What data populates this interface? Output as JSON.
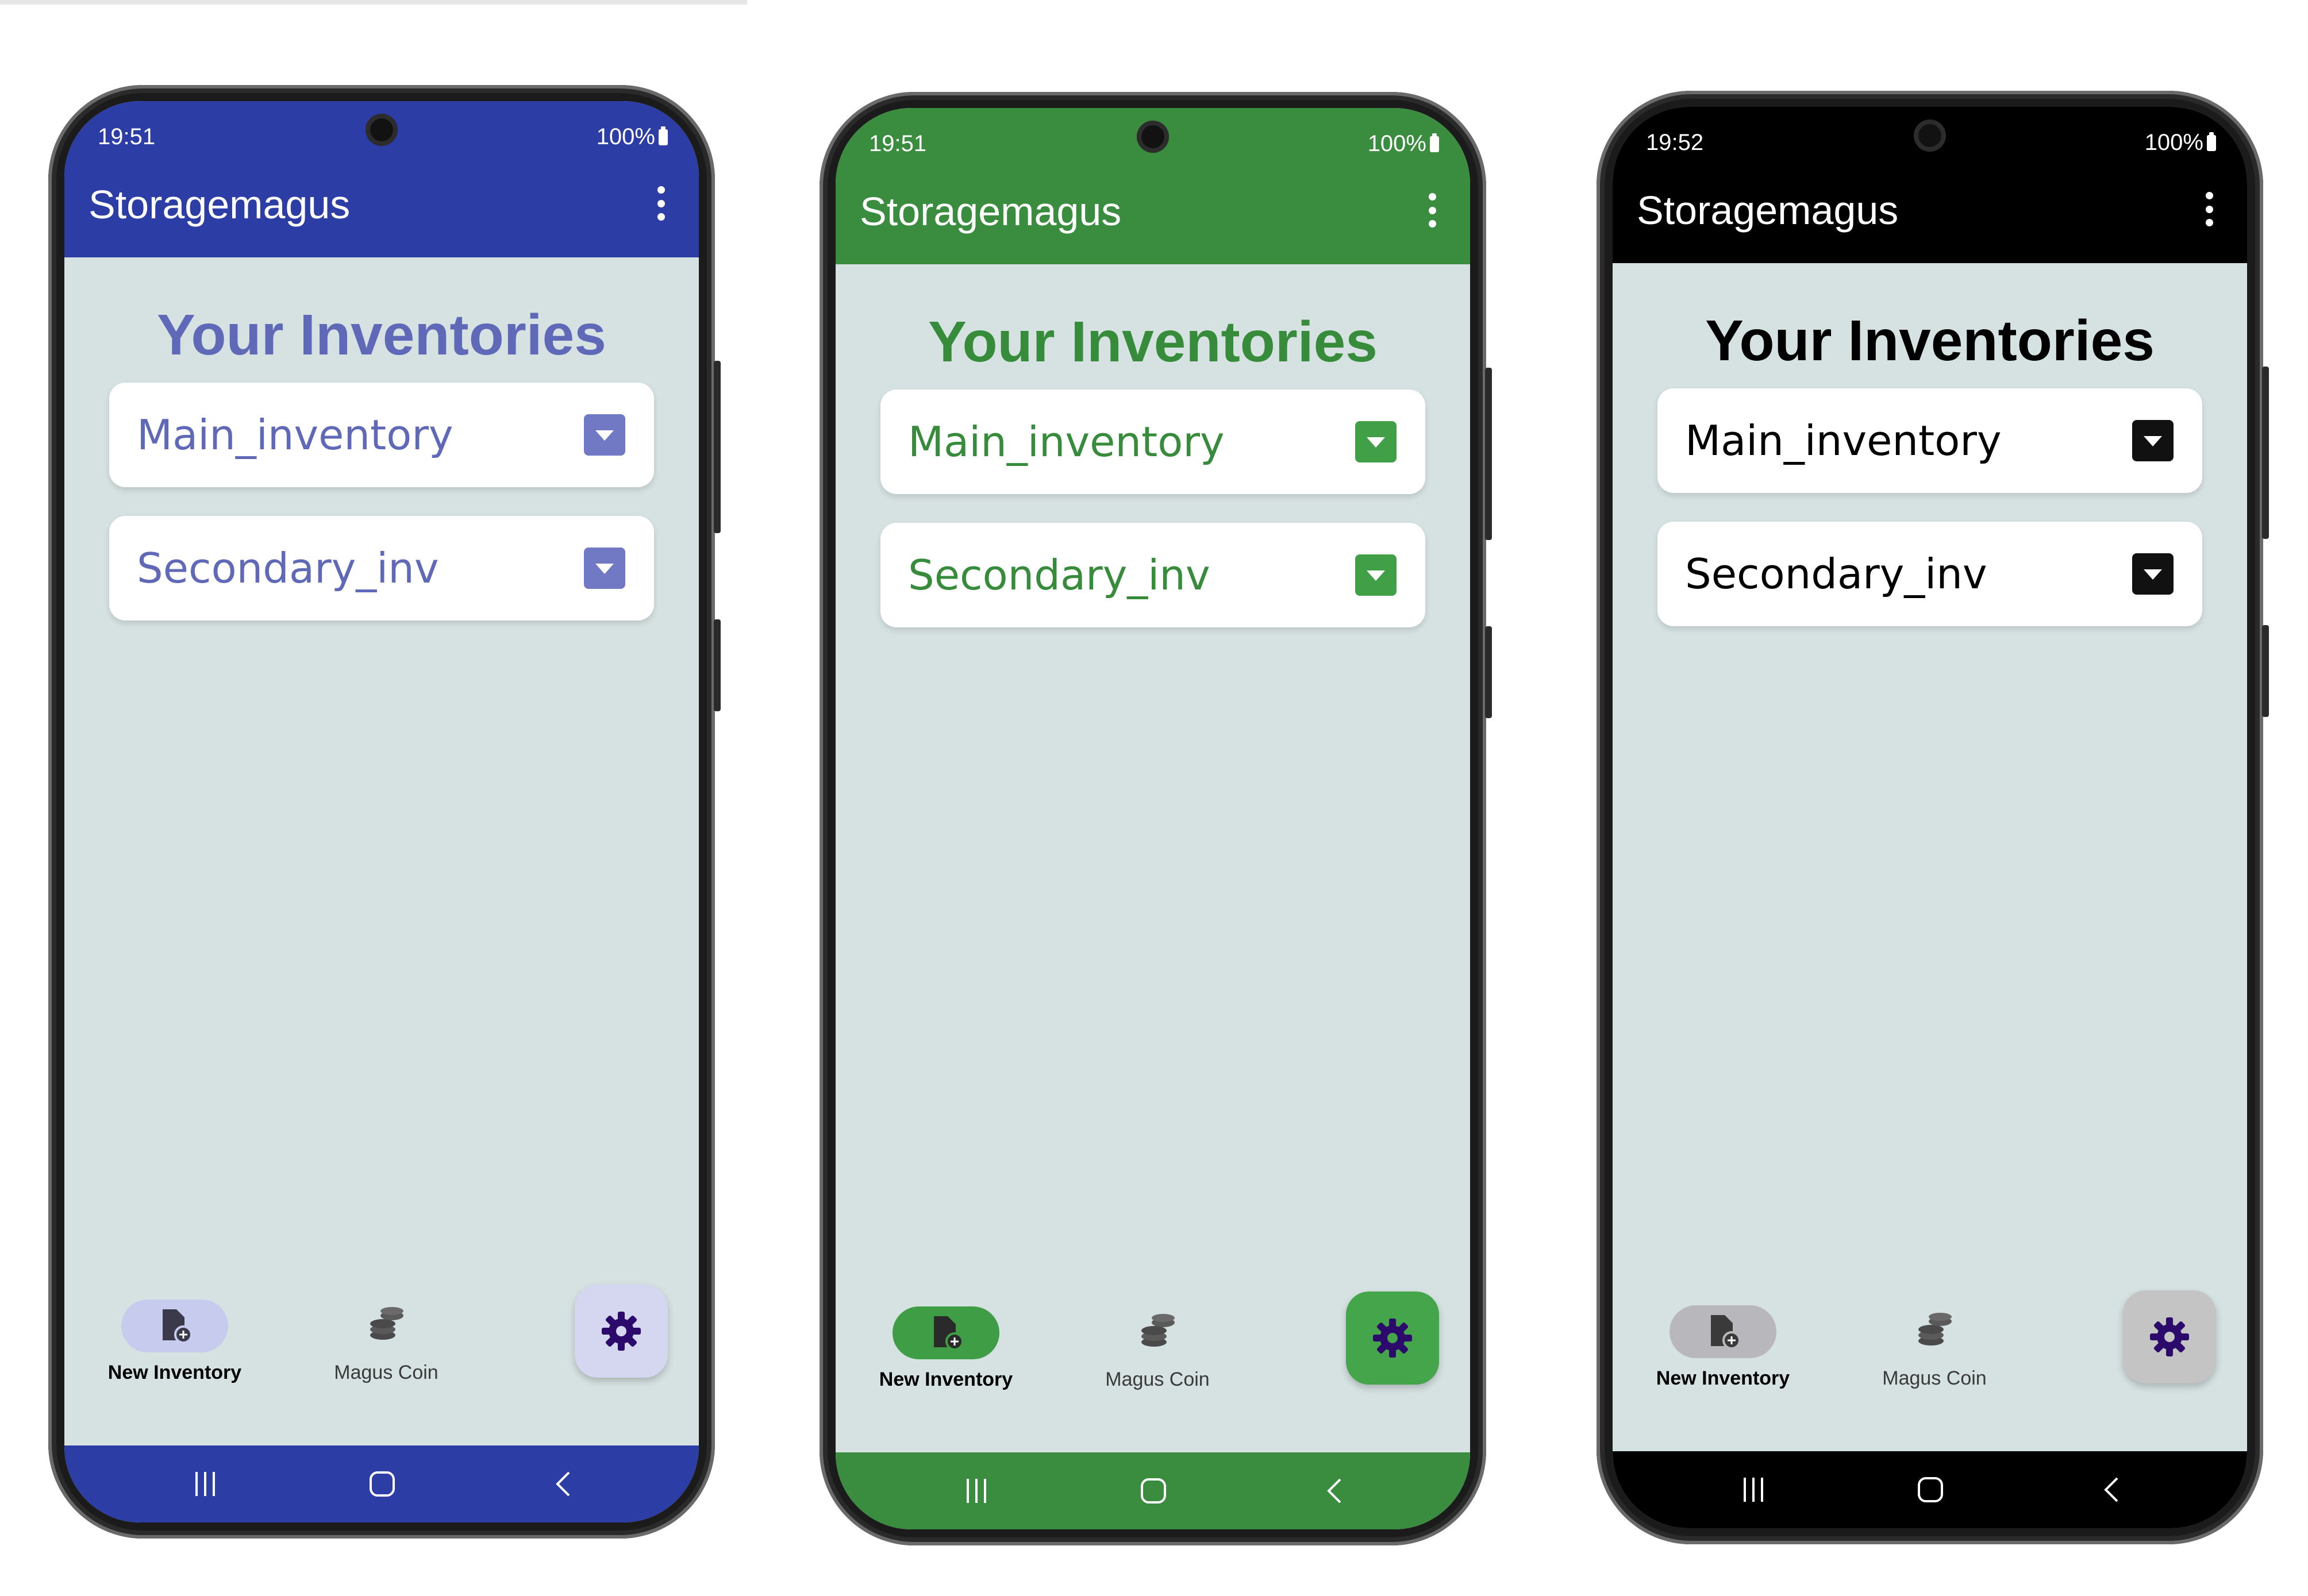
{
  "phones": [
    {
      "theme": "blue",
      "colors": {
        "bar": "#2d3da6",
        "text": "#5f69b8",
        "accent": "#7178c4",
        "nav_pill": "#c7cbee",
        "fab": "#d5d7f1",
        "icon": "#3a3a4a"
      },
      "status": {
        "time": "19:51",
        "battery": "100%"
      },
      "app_title": "Storagemagus",
      "heading": "Your Inventories",
      "inventories": [
        {
          "label": "Main_inventory"
        },
        {
          "label": "Secondary_inv"
        }
      ],
      "nav": {
        "new_inventory": "New Inventory",
        "magus_coin": "Magus Coin"
      }
    },
    {
      "theme": "green",
      "colors": {
        "bar": "#3a8d3e",
        "text": "#378c3b",
        "accent": "#41a047",
        "nav_pill": "#3f9e45",
        "fab": "#45a54b",
        "icon": "#2a2a2a"
      },
      "status": {
        "time": "19:51",
        "battery": "100%"
      },
      "app_title": "Storagemagus",
      "heading": "Your Inventories",
      "inventories": [
        {
          "label": "Main_inventory"
        },
        {
          "label": "Secondary_inv"
        }
      ],
      "nav": {
        "new_inventory": "New Inventory",
        "magus_coin": "Magus Coin"
      }
    },
    {
      "theme": "black",
      "colors": {
        "bar": "#000000",
        "text": "#000000",
        "accent": "#111111",
        "nav_pill": "#b8b8bc",
        "fab": "#c4c4c4",
        "icon": "#3a3a3a"
      },
      "status": {
        "time": "19:52",
        "battery": "100%"
      },
      "app_title": "Storagemagus",
      "heading": "Your Inventories",
      "inventories": [
        {
          "label": "Main_inventory"
        },
        {
          "label": "Secondary_inv"
        }
      ],
      "nav": {
        "new_inventory": "New Inventory",
        "magus_coin": "Magus Coin"
      }
    }
  ]
}
